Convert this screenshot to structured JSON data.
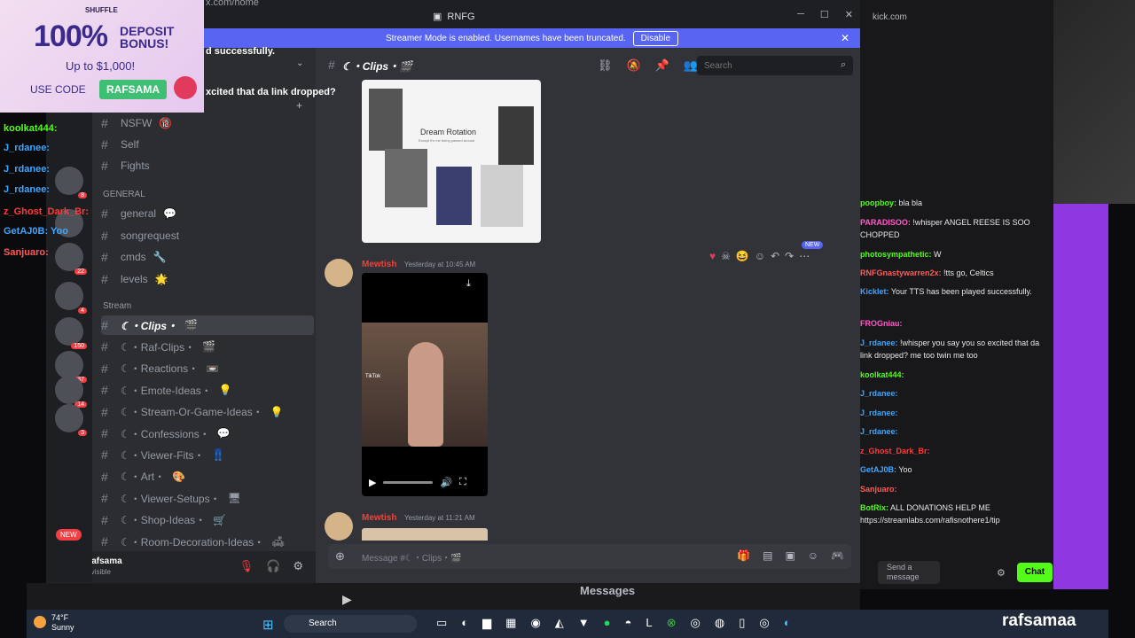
{
  "browser": {
    "url": "x.com/home",
    "window_title": "RNFG"
  },
  "banner": {
    "text": "Streamer Mode is enabled. Usernames have been truncated.",
    "button": "Disable"
  },
  "ad": {
    "brand": "SHUFFLE",
    "headline": "100%",
    "sub1": "DEPOSIT",
    "sub2": "BONUS!",
    "upto": "Up to $1,000!",
    "use_code": "USE CODE",
    "code": "RAFSAMA"
  },
  "overlay_chat": [
    {
      "text": "d successfully.",
      "color": "#ffffff"
    },
    {
      "text": "xcited that da link dropped?",
      "color": "#ffffff"
    },
    {
      "text": "koolkat444:",
      "color": "#53fc18"
    },
    {
      "text": "J_rdanee:",
      "color": "#3ea6ff"
    },
    {
      "text": "J_rdanee:",
      "color": "#3ea6ff"
    },
    {
      "text": "J_rdanee:",
      "color": "#3ea6ff"
    },
    {
      "text": "z_Ghost_Dark_Br:",
      "color": "#ff3b3b"
    },
    {
      "text": "GetAJ0B: Yoo",
      "color": "#3ea6ff"
    },
    {
      "text": "Sanjuaro:",
      "color": "#ff5a5a"
    }
  ],
  "channels_top": [
    {
      "name": "NSFW",
      "emoji": "🔞"
    },
    {
      "name": "Self",
      "emoji": ""
    },
    {
      "name": "Fights",
      "emoji": ""
    }
  ],
  "category_general": "GENERAL",
  "channels_general": [
    {
      "name": "general",
      "emoji": "💬"
    },
    {
      "name": "songrequest",
      "emoji": ""
    },
    {
      "name": "cmds",
      "emoji": "🔧"
    },
    {
      "name": "levels",
      "emoji": "🌟"
    }
  ],
  "category_stream": "Stream",
  "channels_stream": [
    {
      "name": "☾・Clips・",
      "emoji": "🎬",
      "active": true
    },
    {
      "name": "☾・Raf-Clips・",
      "emoji": "🎬"
    },
    {
      "name": "☾・Reactions・",
      "emoji": "📼"
    },
    {
      "name": "☾・Emote-Ideas・",
      "emoji": "💡"
    },
    {
      "name": "☾・Stream-Or-Game-Ideas・",
      "emoji": "💡"
    },
    {
      "name": "☾・Confessions・",
      "emoji": "💬"
    },
    {
      "name": "☾・Viewer-Fits・",
      "emoji": "👖"
    },
    {
      "name": "☾・Art・",
      "emoji": "🎨"
    },
    {
      "name": "☾・Viewer-Setups・",
      "emoji": "🖥"
    },
    {
      "name": "☾・Shop-Ideas・",
      "emoji": "🛒"
    },
    {
      "name": "☾・Room-Decoration-Ideas・",
      "emoji": "🛋"
    }
  ],
  "servers": [
    {
      "badge": "8"
    },
    {
      "badge": ""
    },
    {
      "badge": "22"
    },
    {
      "badge": "4"
    },
    {
      "badge": "150"
    },
    {
      "badge": "37"
    },
    {
      "badge": "14"
    },
    {
      "badge": "3"
    }
  ],
  "server_new": "NEW",
  "user": {
    "name": "Rafsama",
    "status": "Invisible"
  },
  "channel_header": {
    "title": "☾・Clips・🎬",
    "search_placeholder": "Search"
  },
  "image_embed": {
    "title": "Dream Rotation",
    "subtitle": "Except it's me being passed around"
  },
  "messages": [
    {
      "author": "Mewtish",
      "timestamp": "Yesterday at 10:45 AM"
    },
    {
      "author": "Mewtish",
      "timestamp": "Yesterday at 11:21 AM"
    }
  ],
  "video": {
    "watermark": "TikTok"
  },
  "new_badge": "NEW",
  "composer": {
    "placeholder": "Message #☾・Clips・🎬"
  },
  "stream_chat": {
    "platform": "kick.com",
    "lines": [
      {
        "user": "poopboy:",
        "text": "bla bla",
        "color": "#53fc18"
      },
      {
        "user": "PARADISOO:",
        "text": "!whisper ANGEL REESE IS SOO CHOPPED",
        "color": "#ff5ac8"
      },
      {
        "user": "photosympathetic:",
        "text": "W",
        "color": "#53fc18"
      },
      {
        "user": "RNFGnastywarren2x:",
        "text": "!tts go, Celtics",
        "color": "#ff5a5a"
      },
      {
        "user": "Kicklet:",
        "text": "Your TTS has been played successfully.",
        "color": "#3ea6ff"
      },
      {
        "user": "FROGniau:",
        "text": "",
        "color": "#ff5ac8"
      },
      {
        "user": "J_rdanee:",
        "text": "!whisper you say you so excited that da link dropped? me too twin me too",
        "color": "#3ea6ff"
      },
      {
        "user": "koolkat444:",
        "text": "",
        "color": "#53fc18"
      },
      {
        "user": "J_rdanee:",
        "text": "",
        "color": "#3ea6ff"
      },
      {
        "user": "J_rdanee:",
        "text": "",
        "color": "#3ea6ff"
      },
      {
        "user": "J_rdanee:",
        "text": "",
        "color": "#3ea6ff"
      },
      {
        "user": "z_Ghost_Dark_Br:",
        "text": "",
        "color": "#ff3b3b"
      },
      {
        "user": "GetAJ0B:",
        "text": "Yoo",
        "color": "#3ea6ff"
      },
      {
        "user": "Sanjuaro:",
        "text": "",
        "color": "#ff5a5a"
      },
      {
        "user": "BotRix:",
        "text": "ALL DONATIONS HELP ME https://streamlabs.com/rafisnothere1/tip",
        "color": "#53fc18"
      }
    ],
    "input_placeholder": "Send a message",
    "chat_button": "Chat"
  },
  "below": {
    "messages": "Messages"
  },
  "taskbar": {
    "temp": "74°F",
    "condition": "Sunny",
    "search": "Search",
    "channel": "rafsamaa"
  }
}
